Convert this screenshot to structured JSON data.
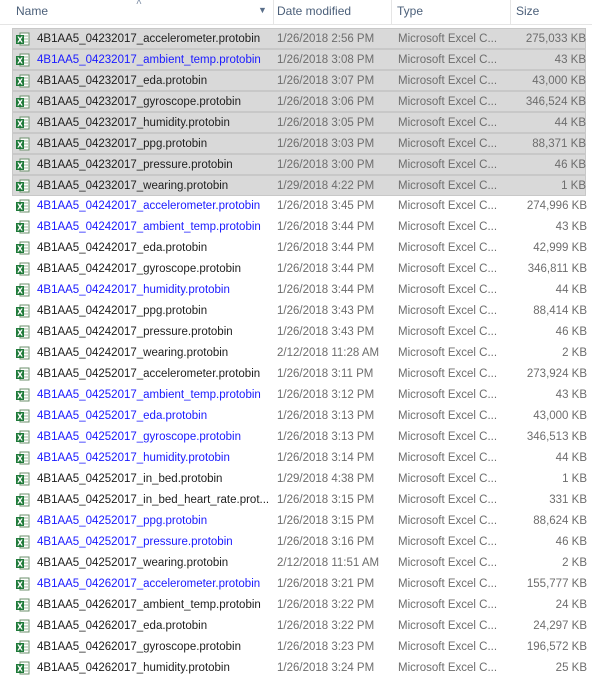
{
  "header": {
    "name": "Name",
    "date_modified": "Date modified",
    "type": "Type",
    "size": "Size",
    "sort_icon": "sort-ascending-icon",
    "dropdown_icon": "chevron-down-icon"
  },
  "colors": {
    "compressed_file_text": "#1a1aff",
    "selection": "#d9d9d9",
    "excel_icon": "#1f7a3a"
  },
  "files": [
    {
      "name": "4B1AA5_04232017_accelerometer.protobin",
      "date": "1/26/2018 2:56 PM",
      "type": "Microsoft Excel C...",
      "size": "275,033 KB",
      "selected": true,
      "blue": false
    },
    {
      "name": "4B1AA5_04232017_ambient_temp.protobin",
      "date": "1/26/2018 3:08 PM",
      "type": "Microsoft Excel C...",
      "size": "43 KB",
      "selected": true,
      "blue": true
    },
    {
      "name": "4B1AA5_04232017_eda.protobin",
      "date": "1/26/2018 3:07 PM",
      "type": "Microsoft Excel C...",
      "size": "43,000 KB",
      "selected": true,
      "blue": false
    },
    {
      "name": "4B1AA5_04232017_gyroscope.protobin",
      "date": "1/26/2018 3:06 PM",
      "type": "Microsoft Excel C...",
      "size": "346,524 KB",
      "selected": true,
      "blue": false
    },
    {
      "name": "4B1AA5_04232017_humidity.protobin",
      "date": "1/26/2018 3:05 PM",
      "type": "Microsoft Excel C...",
      "size": "44 KB",
      "selected": true,
      "blue": false
    },
    {
      "name": "4B1AA5_04232017_ppg.protobin",
      "date": "1/26/2018 3:03 PM",
      "type": "Microsoft Excel C...",
      "size": "88,371 KB",
      "selected": true,
      "blue": false
    },
    {
      "name": "4B1AA5_04232017_pressure.protobin",
      "date": "1/26/2018 3:00 PM",
      "type": "Microsoft Excel C...",
      "size": "46 KB",
      "selected": true,
      "blue": false
    },
    {
      "name": "4B1AA5_04232017_wearing.protobin",
      "date": "1/29/2018 4:22 PM",
      "type": "Microsoft Excel C...",
      "size": "1 KB",
      "selected": true,
      "blue": false
    },
    {
      "name": "4B1AA5_04242017_accelerometer.protobin",
      "date": "1/26/2018 3:45 PM",
      "type": "Microsoft Excel C...",
      "size": "274,996 KB",
      "selected": false,
      "blue": true
    },
    {
      "name": "4B1AA5_04242017_ambient_temp.protobin",
      "date": "1/26/2018 3:44 PM",
      "type": "Microsoft Excel C...",
      "size": "43 KB",
      "selected": false,
      "blue": true
    },
    {
      "name": "4B1AA5_04242017_eda.protobin",
      "date": "1/26/2018 3:44 PM",
      "type": "Microsoft Excel C...",
      "size": "42,999 KB",
      "selected": false,
      "blue": false
    },
    {
      "name": "4B1AA5_04242017_gyroscope.protobin",
      "date": "1/26/2018 3:44 PM",
      "type": "Microsoft Excel C...",
      "size": "346,811 KB",
      "selected": false,
      "blue": false
    },
    {
      "name": "4B1AA5_04242017_humidity.protobin",
      "date": "1/26/2018 3:44 PM",
      "type": "Microsoft Excel C...",
      "size": "44 KB",
      "selected": false,
      "blue": true
    },
    {
      "name": "4B1AA5_04242017_ppg.protobin",
      "date": "1/26/2018 3:43 PM",
      "type": "Microsoft Excel C...",
      "size": "88,414 KB",
      "selected": false,
      "blue": false
    },
    {
      "name": "4B1AA5_04242017_pressure.protobin",
      "date": "1/26/2018 3:43 PM",
      "type": "Microsoft Excel C...",
      "size": "46 KB",
      "selected": false,
      "blue": false
    },
    {
      "name": "4B1AA5_04242017_wearing.protobin",
      "date": "2/12/2018 11:28 AM",
      "type": "Microsoft Excel C...",
      "size": "2 KB",
      "selected": false,
      "blue": false
    },
    {
      "name": "4B1AA5_04252017_accelerometer.protobin",
      "date": "1/26/2018 3:11 PM",
      "type": "Microsoft Excel C...",
      "size": "273,924 KB",
      "selected": false,
      "blue": false
    },
    {
      "name": "4B1AA5_04252017_ambient_temp.protobin",
      "date": "1/26/2018 3:12 PM",
      "type": "Microsoft Excel C...",
      "size": "43 KB",
      "selected": false,
      "blue": true
    },
    {
      "name": "4B1AA5_04252017_eda.protobin",
      "date": "1/26/2018 3:13 PM",
      "type": "Microsoft Excel C...",
      "size": "43,000 KB",
      "selected": false,
      "blue": true
    },
    {
      "name": "4B1AA5_04252017_gyroscope.protobin",
      "date": "1/26/2018 3:13 PM",
      "type": "Microsoft Excel C...",
      "size": "346,513 KB",
      "selected": false,
      "blue": true
    },
    {
      "name": "4B1AA5_04252017_humidity.protobin",
      "date": "1/26/2018 3:14 PM",
      "type": "Microsoft Excel C...",
      "size": "44 KB",
      "selected": false,
      "blue": true
    },
    {
      "name": "4B1AA5_04252017_in_bed.protobin",
      "date": "1/29/2018 4:38 PM",
      "type": "Microsoft Excel C...",
      "size": "1 KB",
      "selected": false,
      "blue": false
    },
    {
      "name": "4B1AA5_04252017_in_bed_heart_rate.prot...",
      "date": "1/26/2018 3:15 PM",
      "type": "Microsoft Excel C...",
      "size": "331 KB",
      "selected": false,
      "blue": false
    },
    {
      "name": "4B1AA5_04252017_ppg.protobin",
      "date": "1/26/2018 3:15 PM",
      "type": "Microsoft Excel C...",
      "size": "88,624 KB",
      "selected": false,
      "blue": true
    },
    {
      "name": "4B1AA5_04252017_pressure.protobin",
      "date": "1/26/2018 3:16 PM",
      "type": "Microsoft Excel C...",
      "size": "46 KB",
      "selected": false,
      "blue": true
    },
    {
      "name": "4B1AA5_04252017_wearing.protobin",
      "date": "2/12/2018 11:51 AM",
      "type": "Microsoft Excel C...",
      "size": "2 KB",
      "selected": false,
      "blue": false
    },
    {
      "name": "4B1AA5_04262017_accelerometer.protobin",
      "date": "1/26/2018 3:21 PM",
      "type": "Microsoft Excel C...",
      "size": "155,777 KB",
      "selected": false,
      "blue": true
    },
    {
      "name": "4B1AA5_04262017_ambient_temp.protobin",
      "date": "1/26/2018 3:22 PM",
      "type": "Microsoft Excel C...",
      "size": "24 KB",
      "selected": false,
      "blue": false
    },
    {
      "name": "4B1AA5_04262017_eda.protobin",
      "date": "1/26/2018 3:22 PM",
      "type": "Microsoft Excel C...",
      "size": "24,297 KB",
      "selected": false,
      "blue": false
    },
    {
      "name": "4B1AA5_04262017_gyroscope.protobin",
      "date": "1/26/2018 3:23 PM",
      "type": "Microsoft Excel C...",
      "size": "196,572 KB",
      "selected": false,
      "blue": false
    },
    {
      "name": "4B1AA5_04262017_humidity.protobin",
      "date": "1/26/2018 3:24 PM",
      "type": "Microsoft Excel C...",
      "size": "25 KB",
      "selected": false,
      "blue": false
    }
  ]
}
